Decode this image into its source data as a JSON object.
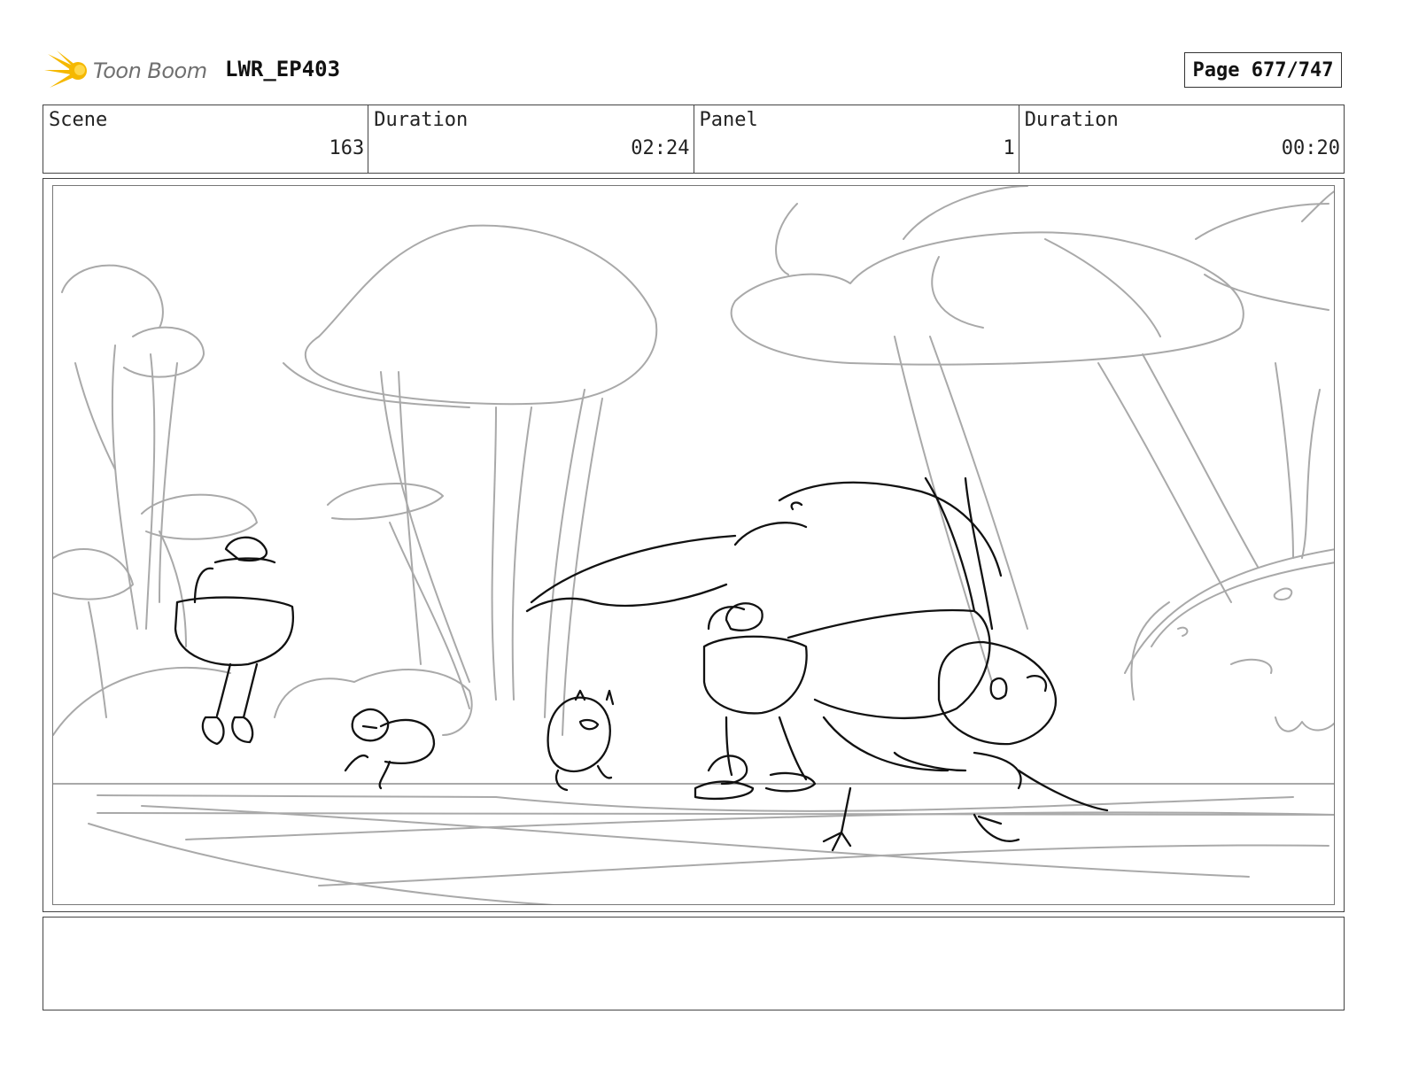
{
  "header": {
    "logo_text": "Toon Boom",
    "project": "LWR_EP403",
    "page": "Page 677/747"
  },
  "info": {
    "scene_label": "Scene",
    "scene_value": "163",
    "scene_duration_label": "Duration",
    "scene_duration_value": "02:24",
    "panel_label": "Panel",
    "panel_value": "1",
    "panel_duration_label": "Duration",
    "panel_duration_value": "00:20"
  },
  "colors": {
    "logo_yellow": "#f5b800",
    "sketch_light": "#a9a9a9",
    "sketch_dark": "#111111"
  },
  "notes": {
    "text": ""
  }
}
